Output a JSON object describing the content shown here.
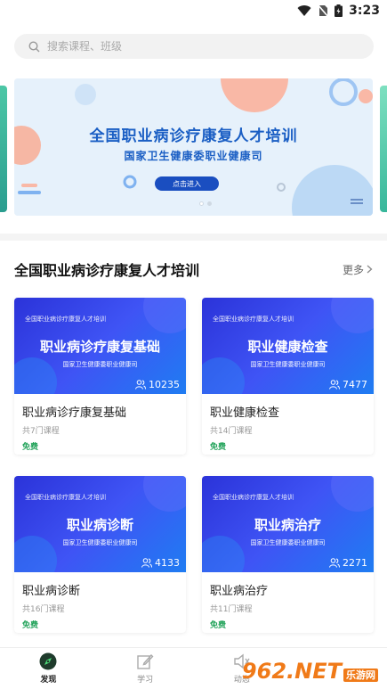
{
  "status": {
    "time": "3:23"
  },
  "search": {
    "placeholder": "搜索课程、班级"
  },
  "banner": {
    "title": "全国职业病诊疗康复人才培训",
    "subtitle": "国家卫生健康委职业健康司",
    "button": "点击进入"
  },
  "section": {
    "title": "全国职业病诊疗康复人才培训",
    "more": "更多"
  },
  "courses": [
    {
      "thumb_top": "全国职业病诊疗康复人才培训",
      "thumb_main": "职业病诊疗康复基础",
      "thumb_sub": "国家卫生健康委职业健康司",
      "count": "10235",
      "name": "职业病诊疗康复基础",
      "meta": "共7门课程",
      "price": "免费"
    },
    {
      "thumb_top": "全国职业病诊疗康复人才培训",
      "thumb_main": "职业健康检查",
      "thumb_sub": "国家卫生健康委职业健康司",
      "count": "7477",
      "name": "职业健康检查",
      "meta": "共14门课程",
      "price": "免费"
    },
    {
      "thumb_top": "全国职业病诊疗康复人才培训",
      "thumb_main": "职业病诊断",
      "thumb_sub": "国家卫生健康委职业健康司",
      "count": "4133",
      "name": "职业病诊断",
      "meta": "共16门课程",
      "price": "免费"
    },
    {
      "thumb_top": "全国职业病诊疗康复人才培训",
      "thumb_main": "职业病治疗",
      "thumb_sub": "国家卫生健康委职业健康司",
      "count": "2271",
      "name": "职业病治疗",
      "meta": "共11门课程",
      "price": "免费"
    }
  ],
  "tabs": [
    {
      "label": "发现",
      "icon": "discover-icon",
      "active": true
    },
    {
      "label": "学习",
      "icon": "edit-icon",
      "active": false
    },
    {
      "label": "动态",
      "icon": "speaker-icon",
      "active": false
    }
  ],
  "watermark": {
    "text": "962.NET",
    "sub": "乐游网"
  }
}
